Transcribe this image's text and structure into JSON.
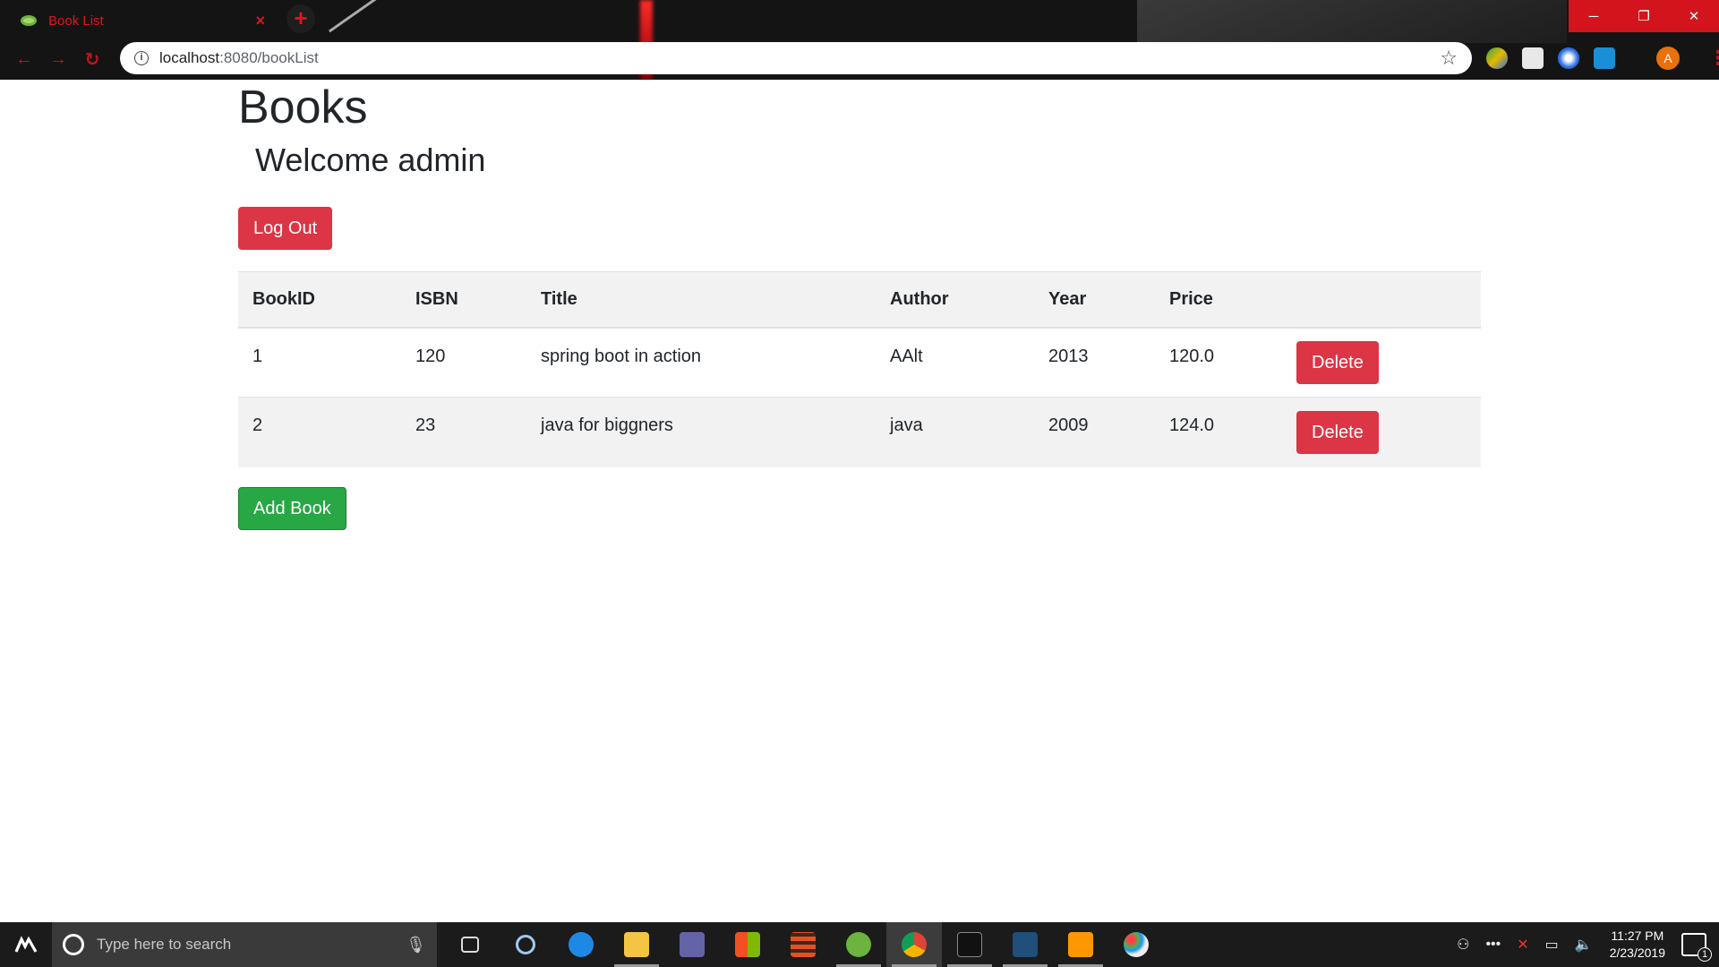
{
  "browser": {
    "tab_title": "Book List",
    "tab_close": "×",
    "new_tab": "+",
    "url_host": "localhost",
    "url_path": ":8080/bookList",
    "avatar_letter": "A",
    "window_controls": {
      "minimize": "─",
      "restore": "❐",
      "close": "✕"
    },
    "accent_color": "#e0141e"
  },
  "page": {
    "title": "Books",
    "welcome": "Welcome admin",
    "logout_label": "Log Out",
    "add_book_label": "Add Book",
    "columns": [
      "BookID",
      "ISBN",
      "Title",
      "Author",
      "Year",
      "Price"
    ],
    "rows": [
      {
        "id": "1",
        "isbn": "120",
        "title": "spring boot in action",
        "author": "AAlt",
        "year": "2013",
        "price": "120.0",
        "action": "Delete"
      },
      {
        "id": "2",
        "isbn": "23",
        "title": "java for biggners",
        "author": "java",
        "year": "2009",
        "price": "124.0",
        "action": "Delete"
      }
    ]
  },
  "taskbar": {
    "search_placeholder": "Type here to search",
    "time": "11:27 PM",
    "date": "2/23/2019",
    "notification_count": "1",
    "apps": [
      "task-view-icon",
      "search-app-icon",
      "edge-icon",
      "file-explorer-icon",
      "teams-icon",
      "store-icon",
      "sublime-merge-icon",
      "spring-tool-icon",
      "chrome-icon",
      "mysql-icon",
      "mysql-workbench-icon",
      "sublime-text-icon",
      "paint-icon"
    ]
  }
}
